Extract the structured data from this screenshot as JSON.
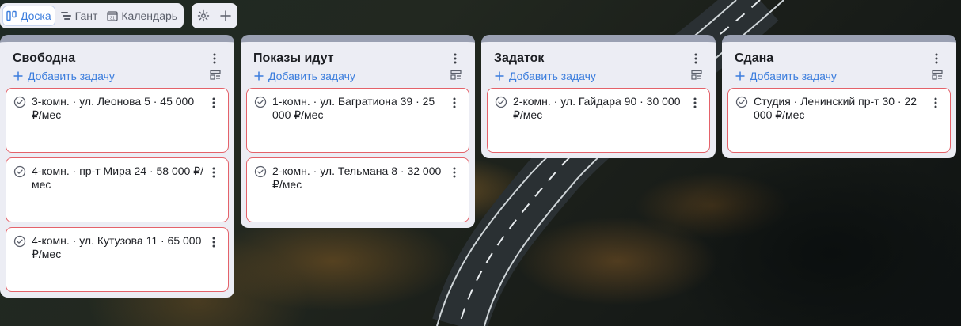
{
  "views": [
    {
      "label": "Доска",
      "icon": "board-icon",
      "active": true
    },
    {
      "label": "Гант",
      "icon": "gantt-icon",
      "active": false
    },
    {
      "label": "Календарь",
      "icon": "calendar-icon",
      "active": false
    }
  ],
  "tools": {
    "settings_icon": "gear-icon",
    "add_icon": "plus-icon"
  },
  "board": {
    "add_task_label": "Добавить задачу",
    "columns": [
      {
        "title": "Свободна",
        "cards": [
          "3-комн. · ул. Леонова 5 · 45 000 ₽/мес",
          "4-комн. · пр-т Мира 24 · 58 000 ₽/мес",
          "4-комн. · ул. Кутузова 11 · 65 000 ₽/мес"
        ]
      },
      {
        "title": "Показы идут",
        "cards": [
          "1-комн. · ул. Багратиона 39 · 25 000 ₽/мес",
          "2-комн. · ул. Тельмана 8 · 32 000 ₽/мес"
        ]
      },
      {
        "title": "Задаток",
        "cards": [
          "2-комн. · ул. Гайдара 90 · 30 000 ₽/мес"
        ]
      },
      {
        "title": "Сдана",
        "cards": [
          "Студия · Ленинский пр-т 30 · 22 000 ₽/мес"
        ]
      }
    ]
  },
  "colors": {
    "accent": "#3b7ddd",
    "card_border": "#e4626a",
    "column_bg": "#ecedf4"
  }
}
